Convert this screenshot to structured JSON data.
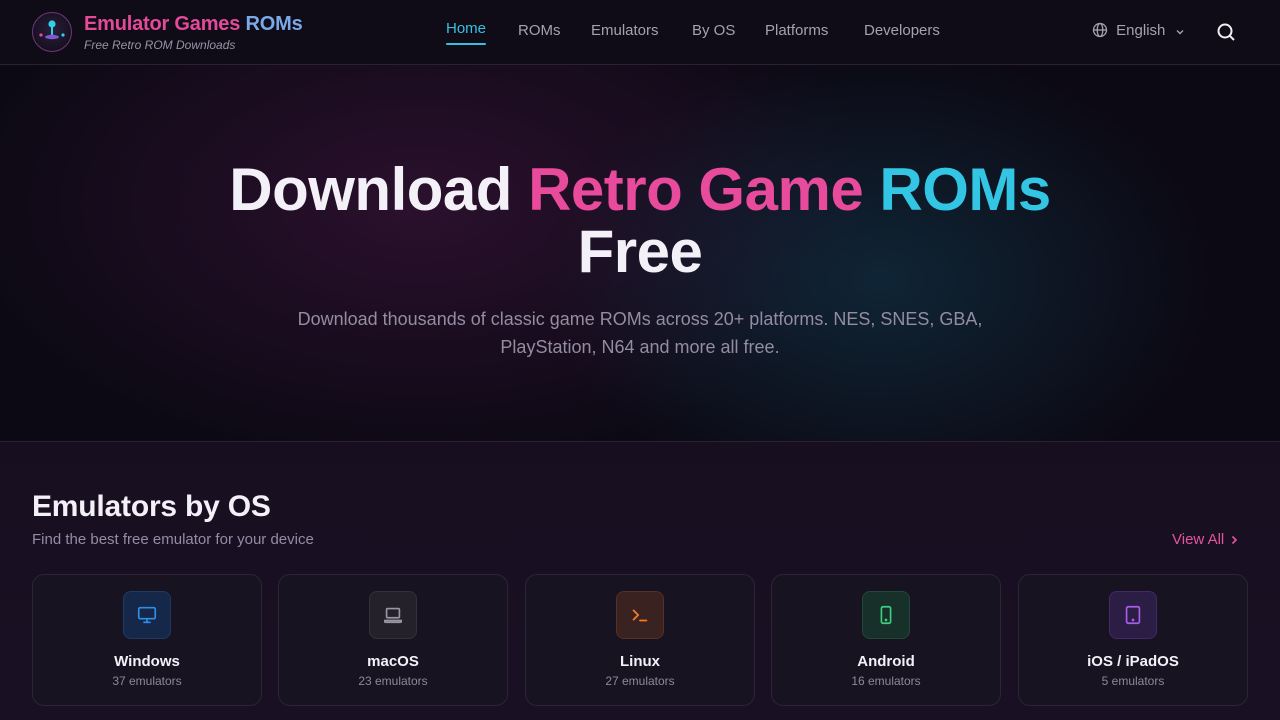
{
  "brand": {
    "title_part1": "Emulator Games ",
    "title_part2": "ROMs",
    "subtitle": "Free Retro ROM Downloads",
    "icon": "joystick-icon"
  },
  "nav": {
    "items": [
      {
        "label": "Home",
        "active": true
      },
      {
        "label": "ROMs"
      },
      {
        "label": "Emulators"
      },
      {
        "label": "By OS"
      },
      {
        "label": "Platforms"
      },
      {
        "label": "Developers"
      }
    ]
  },
  "language": {
    "label": "English",
    "icon": "globe-icon"
  },
  "search": {
    "icon": "search-icon"
  },
  "hero": {
    "title_part1": "Download ",
    "title_part2": "Retro Game ",
    "title_part3": "ROMs",
    "title_part4": "Free",
    "description": "Download thousands of classic game ROMs across 20+ platforms. NES, SNES, GBA, PlayStation, N64 and more all free."
  },
  "section": {
    "title": "Emulators by OS",
    "subtitle": "Find the best free emulator for your device",
    "view_all": "View All"
  },
  "os_cards": [
    {
      "name": "Windows",
      "count": "37 emulators",
      "icon": "monitor-icon",
      "color": "#2f8fe6"
    },
    {
      "name": "macOS",
      "count": "23 emulators",
      "icon": "laptop-icon",
      "color": "#9a95a3"
    },
    {
      "name": "Linux",
      "count": "27 emulators",
      "icon": "terminal-icon",
      "color": "#f07a2a"
    },
    {
      "name": "Android",
      "count": "16 emulators",
      "icon": "smartphone-icon",
      "color": "#3fcf82"
    },
    {
      "name": "iOS / iPadOS",
      "count": "5 emulators",
      "icon": "tablet-icon",
      "color": "#a85ee8"
    }
  ],
  "colors": {
    "accent_pink": "#e84a9c",
    "accent_cyan": "#33c6e4",
    "background": "#120d1b"
  }
}
